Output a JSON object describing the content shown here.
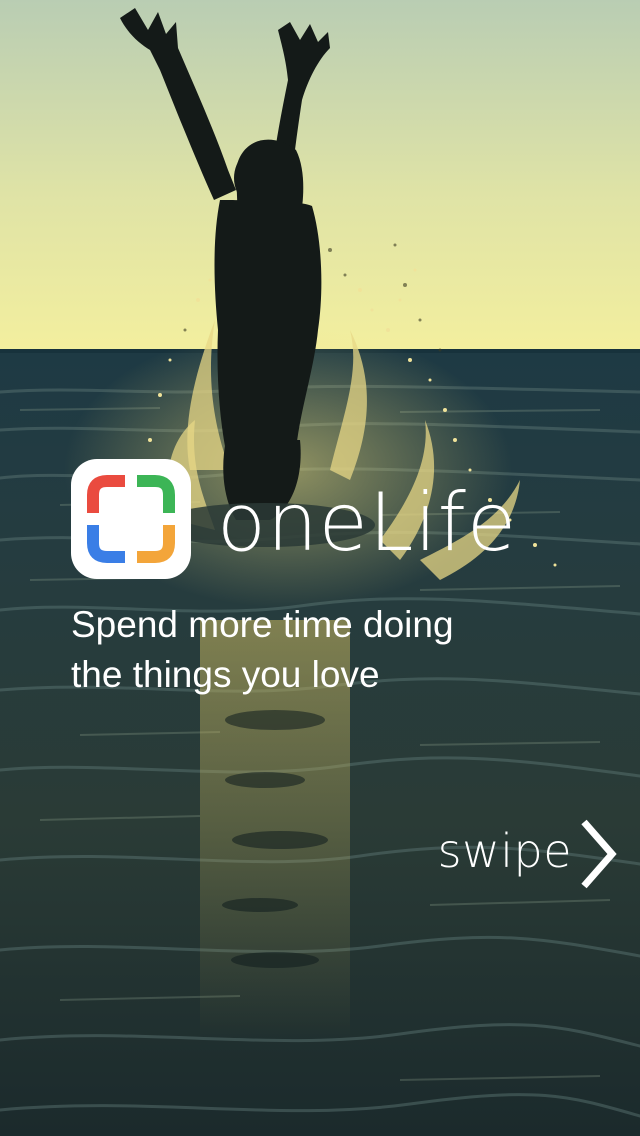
{
  "app": {
    "name": "oneLife",
    "tagline_line1": "Spend more time doing",
    "tagline_line2": "the things you love"
  },
  "swipe": {
    "label": "swipe",
    "icon": "chevron-right-icon"
  },
  "logo": {
    "icon": "app-logo-icon",
    "colors": {
      "top_left": "#ea4b3f",
      "top_right": "#3cb556",
      "bottom_left": "#3a7ee6",
      "bottom_right": "#f3a53a"
    }
  },
  "theme": {
    "text_color": "#ffffff",
    "sky_top": "#c4d6b8",
    "sky_horizon": "#f2ee9c",
    "water_color": "#1f3338"
  }
}
